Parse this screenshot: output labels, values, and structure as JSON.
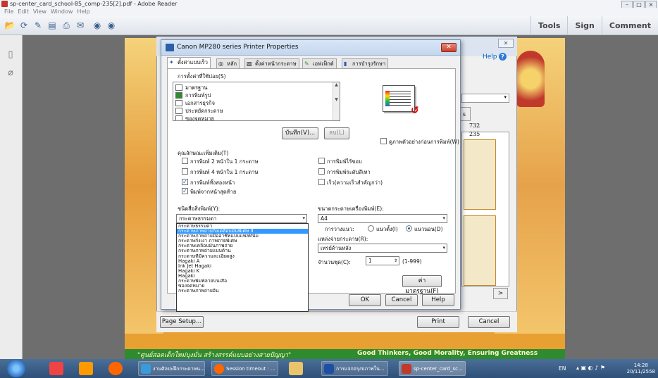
{
  "window": {
    "title": "sp-center_card_school-85_comp-235[2].pdf - Adobe Reader",
    "menu": [
      "File",
      "Edit",
      "View",
      "Window",
      "Help"
    ],
    "right_tools": [
      "Tools",
      "Sign",
      "Comment"
    ]
  },
  "poster": {
    "bottom_left_text": "\"ศูนย์สอดเด็กใหม่บุงมั่น สร้างสรรค์แบบอย่างสายปัญญา\"",
    "bottom_right_text": "Good Thinkers, Good Morality, Ensuring Greatness"
  },
  "print_dialog": {
    "help_label": "Help",
    "side_number": "732",
    "side_number2": "235",
    "next_label": ">",
    "page_setup_label": "Page Setup...",
    "print_label": "Print",
    "cancel_label": "Cancel"
  },
  "props": {
    "title": "Canon MP280 series Printer Properties",
    "tabs": [
      "ตั้งค่าแบบเร็ว",
      "หลัก",
      "ตั้งค่าหน้ากระดาษ",
      "เอฟเฟ็กต์",
      "การบำรุงรักษา"
    ],
    "profiles_label": "การตั้งค่าที่ใช้บ่อย(S)",
    "profiles": [
      "มาตรฐาน",
      "การพิมพ์รูป",
      "เอกสารธุรกิจ",
      "ประหยัดกระดาษ",
      "ซองจดหมาย"
    ],
    "save_label": "บันทึก(V)...",
    "delete_label": "ลบ(L)",
    "always_preview_label": "ดูภาพตัวอย่างก่อนการพิมพ์(W)",
    "features_label": "คุณลักษณะเพิ่มเติม(T)",
    "features": [
      {
        "label": "การพิมพ์ 2 หน้าใน 1 กระดาษ",
        "checked": false
      },
      {
        "label": "การพิมพ์ 4 หน้าใน 1 กระดาษ",
        "checked": false
      },
      {
        "label": "การพิมพ์ทั้งสองหน้า",
        "checked": true
      },
      {
        "label": "พิมพ์จากหน้าสุดท้าย",
        "checked": true
      },
      {
        "label": "การพิมพ์ไร้ขอบ",
        "checked": false
      },
      {
        "label": "การพิมพ์ระดับสีเทา",
        "checked": false
      },
      {
        "label": "เร็ว(ความเร็วสำคัญกว่า)",
        "checked": false
      }
    ],
    "media_type_label": "ชนิดสื่อสิ่งพิมพ์(Y):",
    "media_type_value": "กระดาษธรรมดา",
    "media_types": [
      "กระดาษธรรมดา",
      "กระดาษภาพถ่ายกึ่งเคลือบมันพิเศษ II",
      "กระดาษภาพถ่ายมืออาชีพแบบแพลทินัม",
      "กระดาษกึ่งเงา ภาพถ่ายพิเศษ",
      "กระดาษเคลือบมันภาพถ่าย",
      "กระดาษภาพถ่ายแบบด้าน",
      "กระดาษที่มีความละเอียดสูง",
      "Hagaki A",
      "Ink Jet Hagaki",
      "Hagaki K",
      "Hagaki",
      "กระดาษพิมพ์ลายบนเสื้อ",
      "ซองจดหมาย",
      "กระดาษภาพถ่ายอื่น"
    ],
    "highlighted_index": 1,
    "paper_size_label": "ขนาดกระดาษเครื่องพิมพ์(E):",
    "paper_size_value": "A4",
    "orientation_label": "การวางแนว:",
    "portrait_label": "แนวตั้ง(I)",
    "landscape_label": "แนวนอน(D)",
    "source_label": "แหล่งจ่ายกระดาษ(R):",
    "source_value": "เทรย์ด้านหลัง",
    "copies_label": "จำนวนชุด(C):",
    "copies_value": "1",
    "copies_range": "(1-999)",
    "defaults_label": "ค่ามาตรฐาน(F)",
    "ok_label": "OK",
    "cancel_label": "Cancel",
    "help_label": "Help"
  },
  "taskbar": {
    "items": [
      "งานศิลปะฝึกกระดาษน...",
      "Session timeout : ...",
      "การแจกจรุงปภาพใน...",
      "sp-center_card_sc..."
    ],
    "lang": "EN",
    "time": "14:28",
    "date": "20/11/2558"
  },
  "colors": {
    "accent": "#3399ff",
    "poster_orange": "#e8a033",
    "poster_green": "#2e8b2e",
    "taskbar": "#2e4f78"
  }
}
